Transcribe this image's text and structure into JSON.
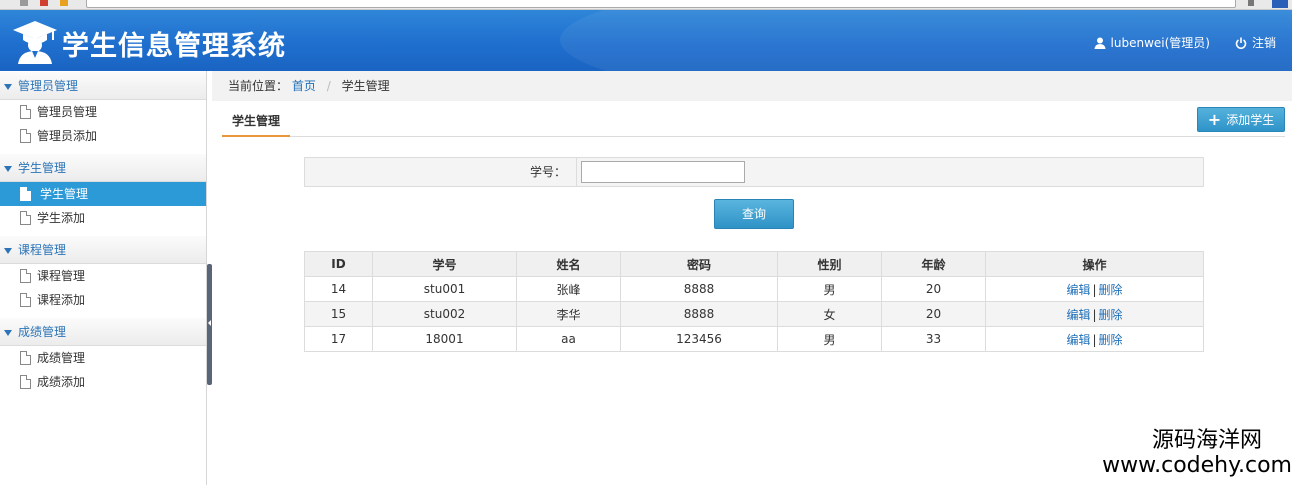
{
  "header": {
    "app_title": "学生信息管理系统",
    "user_label": "lubenwei(管理员)",
    "logout_label": "注销"
  },
  "sidebar": {
    "groups": [
      {
        "title": "管理员管理",
        "items": [
          "管理员管理",
          "管理员添加"
        ]
      },
      {
        "title": "学生管理",
        "items": [
          "学生管理",
          "学生添加"
        ]
      },
      {
        "title": "课程管理",
        "items": [
          "课程管理",
          "课程添加"
        ]
      },
      {
        "title": "成绩管理",
        "items": [
          "成绩管理",
          "成绩添加"
        ]
      }
    ],
    "active_item": "学生管理"
  },
  "breadcrumb": {
    "prefix": "当前位置：",
    "home": "首页",
    "current": "学生管理"
  },
  "tabs": {
    "active": "学生管理"
  },
  "toolbar": {
    "add_label": "添加学生"
  },
  "search": {
    "label": "学号：",
    "value": "",
    "button": "查询"
  },
  "table": {
    "headers": [
      "ID",
      "学号",
      "姓名",
      "密码",
      "性别",
      "年龄",
      "操作"
    ],
    "rows": [
      {
        "id": "14",
        "sno": "stu001",
        "name": "张峰",
        "password": "8888",
        "gender": "男",
        "age": "20"
      },
      {
        "id": "15",
        "sno": "stu002",
        "name": "李华",
        "password": "8888",
        "gender": "女",
        "age": "20"
      },
      {
        "id": "17",
        "sno": "18001",
        "name": "aa",
        "password": "123456",
        "gender": "男",
        "age": "33"
      }
    ],
    "edit_label": "编辑",
    "op_separator": "|",
    "delete_label": "删除"
  },
  "watermark": {
    "line1": "源码海洋网",
    "line2": "www.codehy.com"
  },
  "colors": {
    "header_blue": "#1f6fcf",
    "active_item": "#2d9ad8",
    "link": "#1e6fb8",
    "tab_underline": "#e8973a"
  },
  "icons": [
    "graduate-logo-icon",
    "user-icon",
    "power-icon",
    "triangle-down-icon",
    "document-icon",
    "plus-icon"
  ]
}
